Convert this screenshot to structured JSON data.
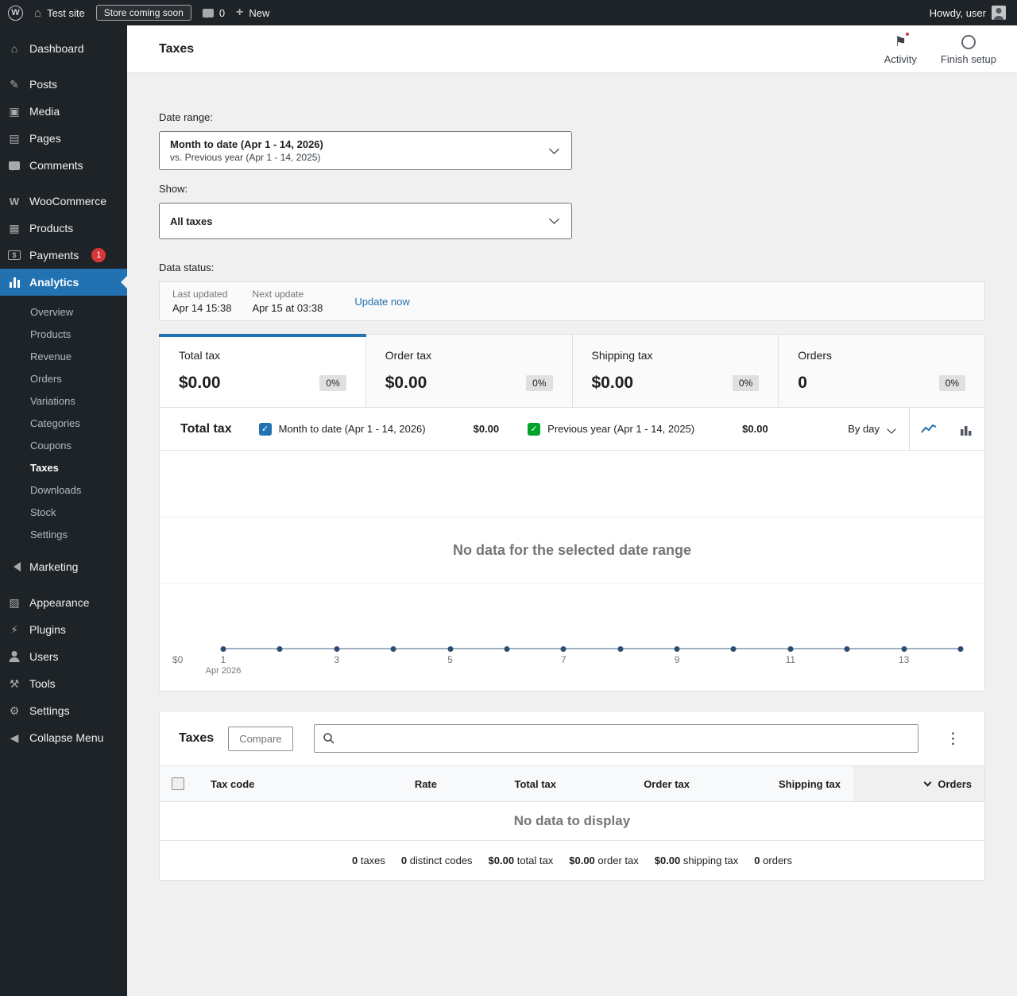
{
  "colors": {
    "accent": "#2271b1",
    "sidebar_bg": "#1d2327",
    "badge_red": "#d63638",
    "series_current": "#2271b1",
    "series_previous": "#00a32a",
    "chart_line": "#a4b1c4",
    "chart_point": "#2f4d73"
  },
  "admin_bar": {
    "site_name": "Test site",
    "coming_soon_badge": "Store coming soon",
    "comment_count": "0",
    "new_label": "New",
    "howdy": "Howdy, user"
  },
  "sidebar": {
    "dashboard": "Dashboard",
    "posts": "Posts",
    "media": "Media",
    "pages": "Pages",
    "comments": "Comments",
    "woocommerce": "WooCommerce",
    "products": "Products",
    "payments": "Payments",
    "payments_badge": "1",
    "analytics": "Analytics",
    "analytics_submenu": [
      "Overview",
      "Products",
      "Revenue",
      "Orders",
      "Variations",
      "Categories",
      "Coupons",
      "Taxes",
      "Downloads",
      "Stock",
      "Settings"
    ],
    "active_submenu_item": "Taxes",
    "marketing": "Marketing",
    "appearance": "Appearance",
    "plugins": "Plugins",
    "users": "Users",
    "tools": "Tools",
    "settings": "Settings",
    "collapse_menu": "Collapse Menu"
  },
  "header": {
    "title": "Taxes",
    "activity_label": "Activity",
    "finish_setup_label": "Finish setup"
  },
  "filters": {
    "date_range_label": "Date range:",
    "date_range_value": "Month to date (Apr 1 - 14, 2026)",
    "date_range_compare": "vs. Previous year (Apr 1 - 14, 2025)",
    "show_label": "Show:",
    "show_value": "All taxes"
  },
  "data_status": {
    "heading": "Data status:",
    "last_updated_label": "Last updated",
    "last_updated_value": "Apr 14 15:38",
    "next_update_label": "Next update",
    "next_update_value": "Apr 15 at 03:38",
    "update_now_label": "Update now"
  },
  "summary_tiles": [
    {
      "label": "Total tax",
      "value": "$0.00",
      "delta": "0%",
      "selected": true
    },
    {
      "label": "Order tax",
      "value": "$0.00",
      "delta": "0%",
      "selected": false
    },
    {
      "label": "Shipping tax",
      "value": "$0.00",
      "delta": "0%",
      "selected": false
    },
    {
      "label": "Orders",
      "value": "0",
      "delta": "0%",
      "selected": false
    }
  ],
  "chart": {
    "title": "Total tax",
    "legend": [
      {
        "label": "Month to date (Apr 1 - 14, 2026)",
        "value": "$0.00",
        "color": "#2271b1"
      },
      {
        "label": "Previous year (Apr 1 - 14, 2025)",
        "value": "$0.00",
        "color": "#00a32a"
      }
    ],
    "interval": "By day"
  },
  "chart_data": {
    "type": "line",
    "title": "Total tax",
    "x": [
      1,
      2,
      3,
      4,
      5,
      6,
      7,
      8,
      9,
      10,
      11,
      12,
      13,
      14
    ],
    "series": [
      {
        "name": "Month to date (Apr 1 - 14, 2026)",
        "values": [
          0,
          0,
          0,
          0,
          0,
          0,
          0,
          0,
          0,
          0,
          0,
          0,
          0,
          0
        ]
      },
      {
        "name": "Previous year (Apr 1 - 14, 2025)",
        "values": [
          0,
          0,
          0,
          0,
          0,
          0,
          0,
          0,
          0,
          0,
          0,
          0,
          0,
          0
        ]
      }
    ],
    "ylim": [
      0,
      0
    ],
    "y_tick_label": "$0",
    "x_tick_labels": [
      "1",
      "3",
      "5",
      "7",
      "9",
      "11",
      "13"
    ],
    "x_axis_sublabel": "Apr 2026",
    "empty_message": "No data for the selected date range",
    "grid": true,
    "legend_position": "top"
  },
  "table": {
    "title": "Taxes",
    "compare_label": "Compare",
    "search_value": "",
    "columns": [
      "Tax code",
      "Rate",
      "Total tax",
      "Order tax",
      "Shipping tax",
      "Orders"
    ],
    "sorted_column": "Orders",
    "empty_message": "No data to display",
    "summary": [
      {
        "value": "0",
        "label": "taxes"
      },
      {
        "value": "0",
        "label": "distinct codes"
      },
      {
        "value": "$0.00",
        "label": "total tax"
      },
      {
        "value": "$0.00",
        "label": "order tax"
      },
      {
        "value": "$0.00",
        "label": "shipping tax"
      },
      {
        "value": "0",
        "label": "orders"
      }
    ]
  }
}
